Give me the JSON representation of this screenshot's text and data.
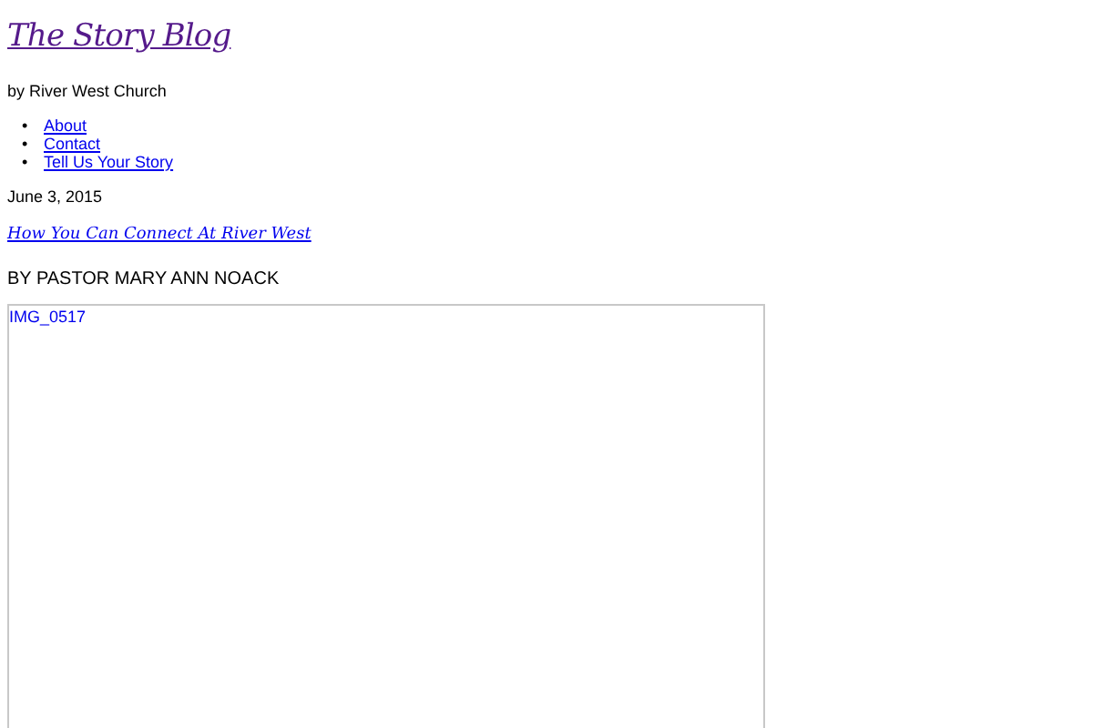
{
  "site": {
    "title": "The Story Blog",
    "tagline": "by River West Church"
  },
  "nav": [
    {
      "marker": "•",
      "label": "About"
    },
    {
      "marker": "•",
      "label": "Contact"
    },
    {
      "marker": "•",
      "label": "Tell Us Your Story"
    }
  ],
  "post": {
    "date": "June 3, 2015",
    "title": "How You Can Connect At River West",
    "byline": "BY PASTOR MARY ANN NOACK",
    "image_alt": "IMG_0517"
  }
}
